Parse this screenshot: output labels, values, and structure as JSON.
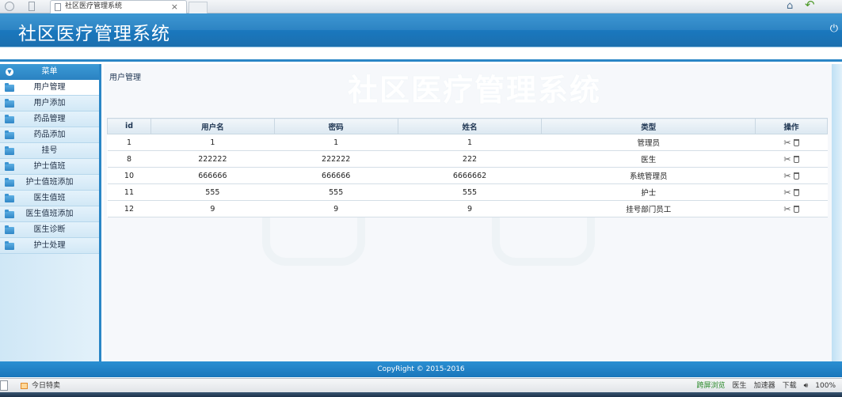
{
  "browser": {
    "tab_title": "社区医疗管理系统",
    "tab_close": "×"
  },
  "header": {
    "title": "社区医疗管理系统"
  },
  "sidebar": {
    "heading": "菜单",
    "items": [
      {
        "label": "用户管理"
      },
      {
        "label": "用户添加"
      },
      {
        "label": "药品管理"
      },
      {
        "label": "药品添加"
      },
      {
        "label": "挂号"
      },
      {
        "label": "护士值班"
      },
      {
        "label": "护士值班添加"
      },
      {
        "label": "医生值班"
      },
      {
        "label": "医生值班添加"
      },
      {
        "label": "医生诊断"
      },
      {
        "label": "护士处理"
      }
    ]
  },
  "main": {
    "breadcrumb": "用户管理",
    "watermark": "社区医疗管理系统",
    "table": {
      "headers": [
        "id",
        "用户名",
        "密码",
        "姓名",
        "类型",
        "操作"
      ],
      "rows": [
        [
          "1",
          "1",
          "1",
          "1",
          "管理员"
        ],
        [
          "8",
          "222222",
          "222222",
          "222",
          "医生"
        ],
        [
          "10",
          "666666",
          "666666",
          "6666662",
          "系统管理员"
        ],
        [
          "11",
          "555",
          "555",
          "555",
          "护士"
        ],
        [
          "12",
          "9",
          "9",
          "9",
          "挂号部门员工"
        ]
      ]
    }
  },
  "footer": {
    "copyright": "CopyRight © 2015-2016"
  },
  "statusbar": {
    "today": "今日特卖",
    "cross_screen": "跨屏浏览",
    "doctor": "医生",
    "accelerator": "加速器",
    "download": "下载",
    "zoom": "100%"
  },
  "colors": {
    "header_blue": "#1a77bd",
    "sidebar_bg": "#d2e8f6",
    "accent": "#2a86c6"
  }
}
